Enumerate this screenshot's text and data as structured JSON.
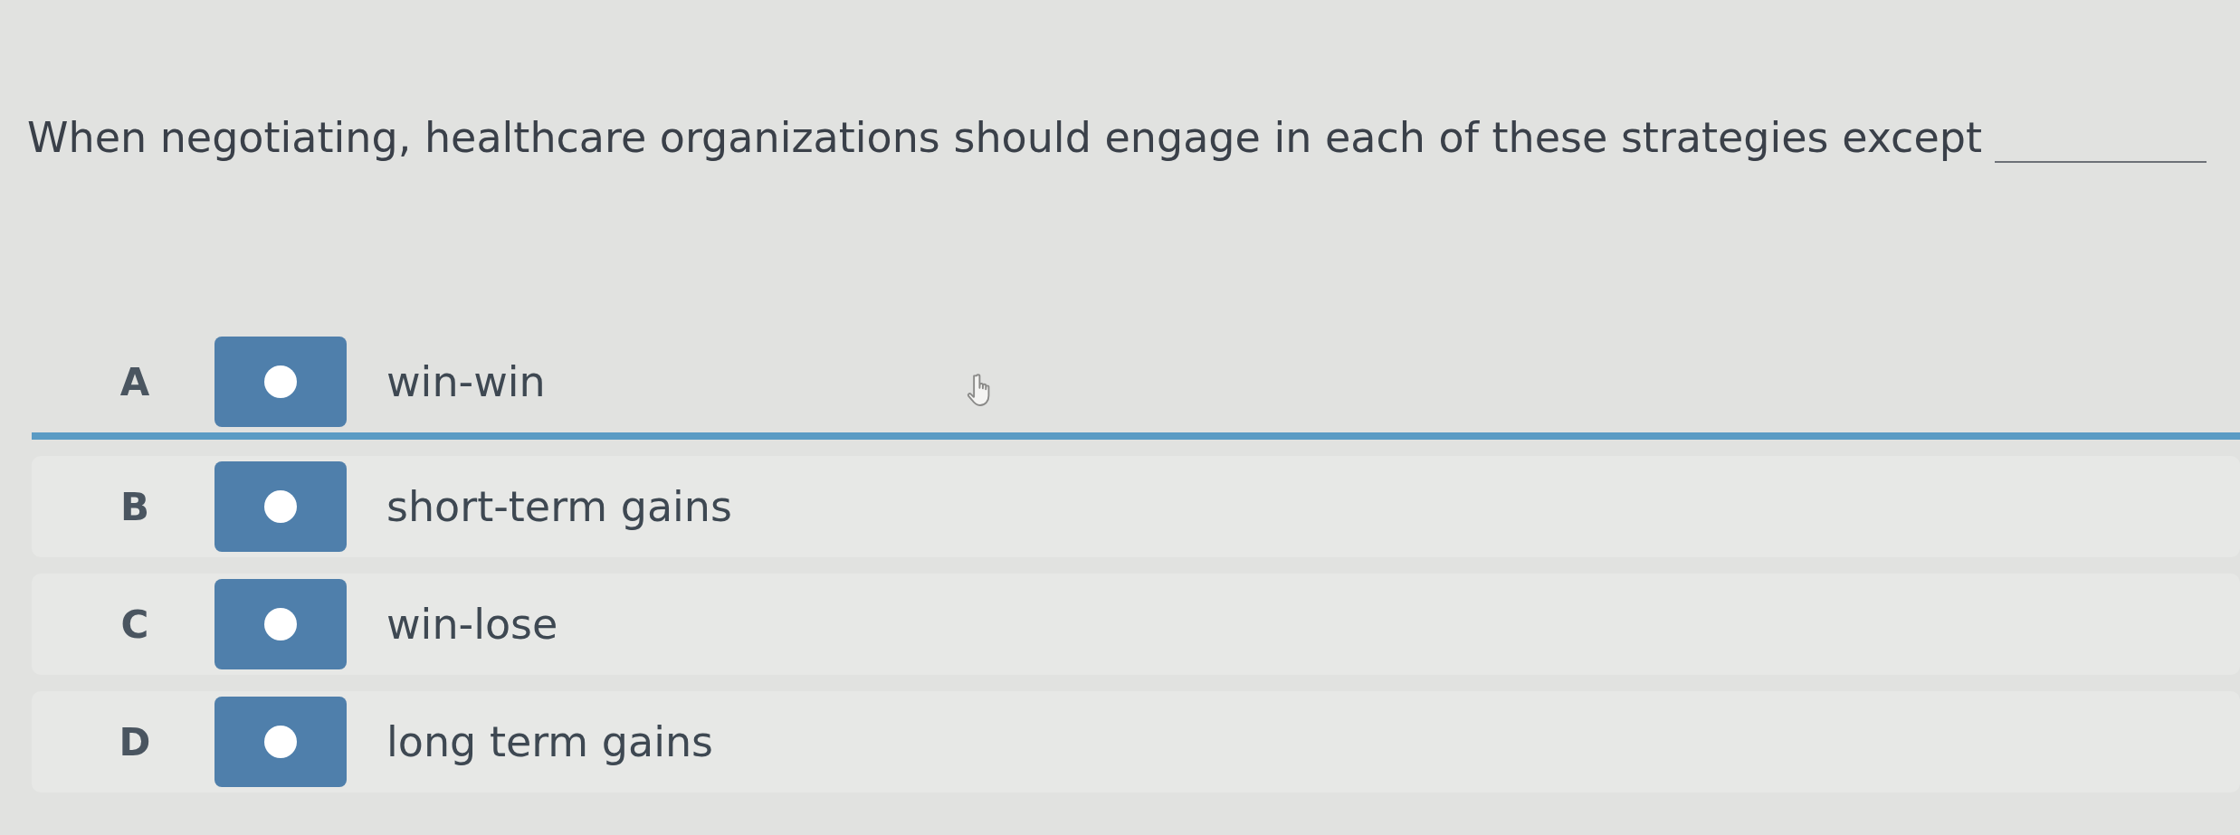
{
  "question": {
    "text": "When negotiating, healthcare organizations should engage in each of these strategies except"
  },
  "options": [
    {
      "letter": "A",
      "text": "win-win",
      "selected": false,
      "hovered": true
    },
    {
      "letter": "B",
      "text": "short-term gains",
      "selected": false,
      "hovered": false
    },
    {
      "letter": "C",
      "text": "win-lose",
      "selected": false,
      "hovered": false
    },
    {
      "letter": "D",
      "text": "long term gains",
      "selected": false,
      "hovered": false
    }
  ]
}
